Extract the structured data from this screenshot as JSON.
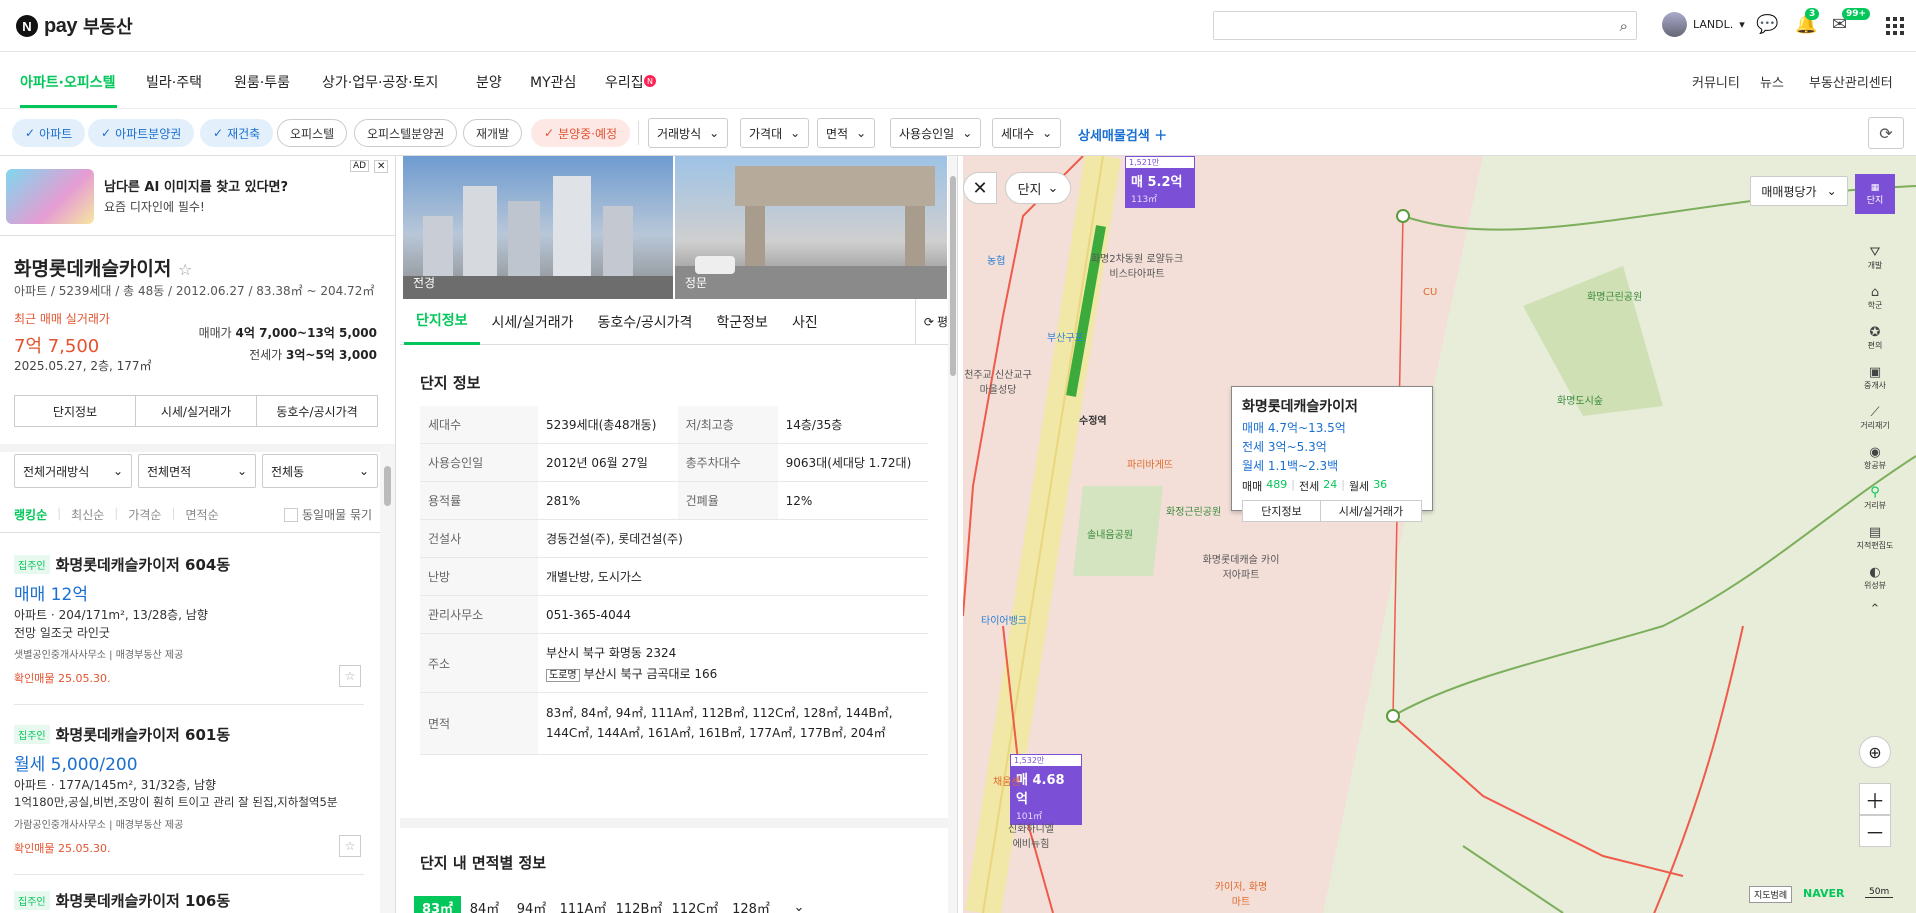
{
  "header": {
    "brand_pay": "pay",
    "brand_re": "부동산",
    "search_placeholder": "",
    "user": "LANDL.",
    "bell_badge": "3",
    "mail_badge": "99+"
  },
  "nav": {
    "items": [
      "아파트·오피스텔",
      "빌라·주택",
      "원룸·투룸",
      "상가·업무·공장·토지",
      "분양",
      "MY관심",
      "우리집"
    ],
    "right": [
      "커뮤니티",
      "뉴스",
      "부동산관리센터"
    ]
  },
  "filters": {
    "chips": [
      "아파트",
      "아파트분양권",
      "재건축",
      "오피스텔",
      "오피스텔분양권",
      "재개발",
      "분양중·예정"
    ],
    "drops": [
      "거래방식",
      "가격대",
      "면적",
      "사용승인일",
      "세대수"
    ],
    "advanced": "상세매물검색"
  },
  "ad": {
    "title": "남다른 AI 이미지를 찾고 있다면?",
    "sub": "요즘 디자인에 필수!",
    "tag": "AD"
  },
  "complex": {
    "name": "화명롯데캐슬카이저",
    "meta": "아파트 / 5239세대 / 총 48동 / 2012.06.27 / 83.38㎡ ~ 204.72㎡",
    "recent_label": "최근 매매 실거래가",
    "recent_price": "7억 7,500",
    "recent_date": "2025.05.27, 2층, 177㎡",
    "sale_label": "매매가",
    "sale_range": "4억 7,000~13억 5,000",
    "jeonse_label": "전세가",
    "jeonse_range": "3억~5억 3,000",
    "buttons": [
      "단지정보",
      "시세/실거래가",
      "동호수/공시가격"
    ]
  },
  "list_filters": {
    "selects": [
      "전체거래방식",
      "전체면적",
      "전체동"
    ],
    "sorts": [
      "랭킹순",
      "최신순",
      "가격순",
      "면적순"
    ],
    "group_label": "동일매물 묶기"
  },
  "listings": [
    {
      "tag": "집주인",
      "name": "화명롯데캐슬카이저 604동",
      "price": "매매 12억",
      "info": "아파트 · 204/171m², 13/28층, 남향",
      "desc": "전망 일조굿 라인굿",
      "src": "샛별공인중개사사무소 | 매경부동산 제공",
      "confirm": "확인매물 25.05.30."
    },
    {
      "tag": "집주인",
      "name": "화명롯데캐슬카이저 601동",
      "price": "월세 5,000/200",
      "info": "아파트 · 177A/145m², 31/32층, 남향",
      "desc": "1억180만,공실,비번,조망이 훤히 트이고 관리 잘 된집,지하철역5분",
      "src": "가람공인중개사사무소 | 매경부동산 제공",
      "confirm": "확인매물 25.05.30."
    },
    {
      "tag": "집주인",
      "name": "화명롯데캐슬카이저 106동"
    }
  ],
  "detail": {
    "photo_labels": [
      "전경",
      "정문"
    ],
    "tabs": [
      "단지정보",
      "시세/실거래가",
      "동호수/공시가격",
      "학군정보",
      "사진"
    ],
    "tab_more": "평",
    "section_title": "단지 정보",
    "rows": [
      {
        "k": "세대수",
        "v": "5239세대(총48개동)",
        "k2": "저/최고층",
        "v2": "14층/35층"
      },
      {
        "k": "사용승인일",
        "v": "2012년 06월 27일",
        "k2": "총주차대수",
        "v2": "9063대(세대당 1.72대)"
      },
      {
        "k": "용적률",
        "v": "281%",
        "k2": "건폐율",
        "v2": "12%"
      },
      {
        "k": "건설사",
        "v": "경동건설(주), 롯데건설(주)"
      },
      {
        "k": "난방",
        "v": "개별난방, 도시가스"
      },
      {
        "k": "관리사무소",
        "v": "051-365-4044"
      },
      {
        "k": "주소",
        "v": "부산시 북구 화명동 2324",
        "road_tag": "도로명",
        "v_road": "부산시 북구 금곡대로 166"
      },
      {
        "k": "면적",
        "v": "83㎡, 84㎡, 94㎡, 111A㎡, 112B㎡, 112C㎡, 128㎡, 144B㎡, 144C㎡, 144A㎡, 161A㎡, 161B㎡, 177A㎡, 177B㎡, 204㎡"
      }
    ],
    "section2": "단지 내 면적별 정보",
    "area_tabs": [
      "83㎡",
      "84㎡",
      "94㎡",
      "111A㎡",
      "112B㎡",
      "112C㎡",
      "128㎡"
    ]
  },
  "map": {
    "filter": "단지",
    "sort": "매매평당가",
    "view_btn": "단지",
    "right_tools": [
      "개발",
      "학군",
      "편의",
      "중개사",
      "거리재기",
      "항공뷰",
      "거리뷰",
      "지적편집도",
      "위성뷰"
    ],
    "pin1": {
      "count": "1,521만",
      "price": "매 5.2억",
      "area": "113㎡"
    },
    "pin2": {
      "count": "1,532만",
      "price": "매 4.68억",
      "area": "101㎡"
    },
    "popup": {
      "name": "화명롯데캐슬카이저",
      "sale": "매매 4.7억~13.5억",
      "jeonse": "전세 3억~5.3억",
      "monthly": "월세 1.1백~2.3백",
      "cnt_sale_label": "매매",
      "cnt_sale": "489",
      "cnt_jeonse_label": "전세",
      "cnt_jeonse": "24",
      "cnt_month_label": "월세",
      "cnt_month": "36",
      "btn1": "단지정보",
      "btn2": "시세/실거래가"
    },
    "labels": [
      "화명2차동원 로얄듀크비스타아파트",
      "농협",
      "부산구포",
      "화정근린공원",
      "화명근린공원",
      "화명도시숲",
      "파리바게뜨",
      "솔내음공원",
      "타이어뱅크",
      "수정역",
      "화명롯데캐슬 카이저아파트",
      "CU",
      "채움센",
      "신화하니엘 에비뉴힘",
      "카이저, 화명마트",
      "천주교 신산교구 마을성당"
    ],
    "scale": "50m",
    "naver": "NAVER",
    "legal": "지도범례"
  },
  "colors": {
    "green": "#03c75a",
    "blue": "#1a6fd0",
    "red": "#e3532f",
    "purple": "#7b4fd6"
  }
}
